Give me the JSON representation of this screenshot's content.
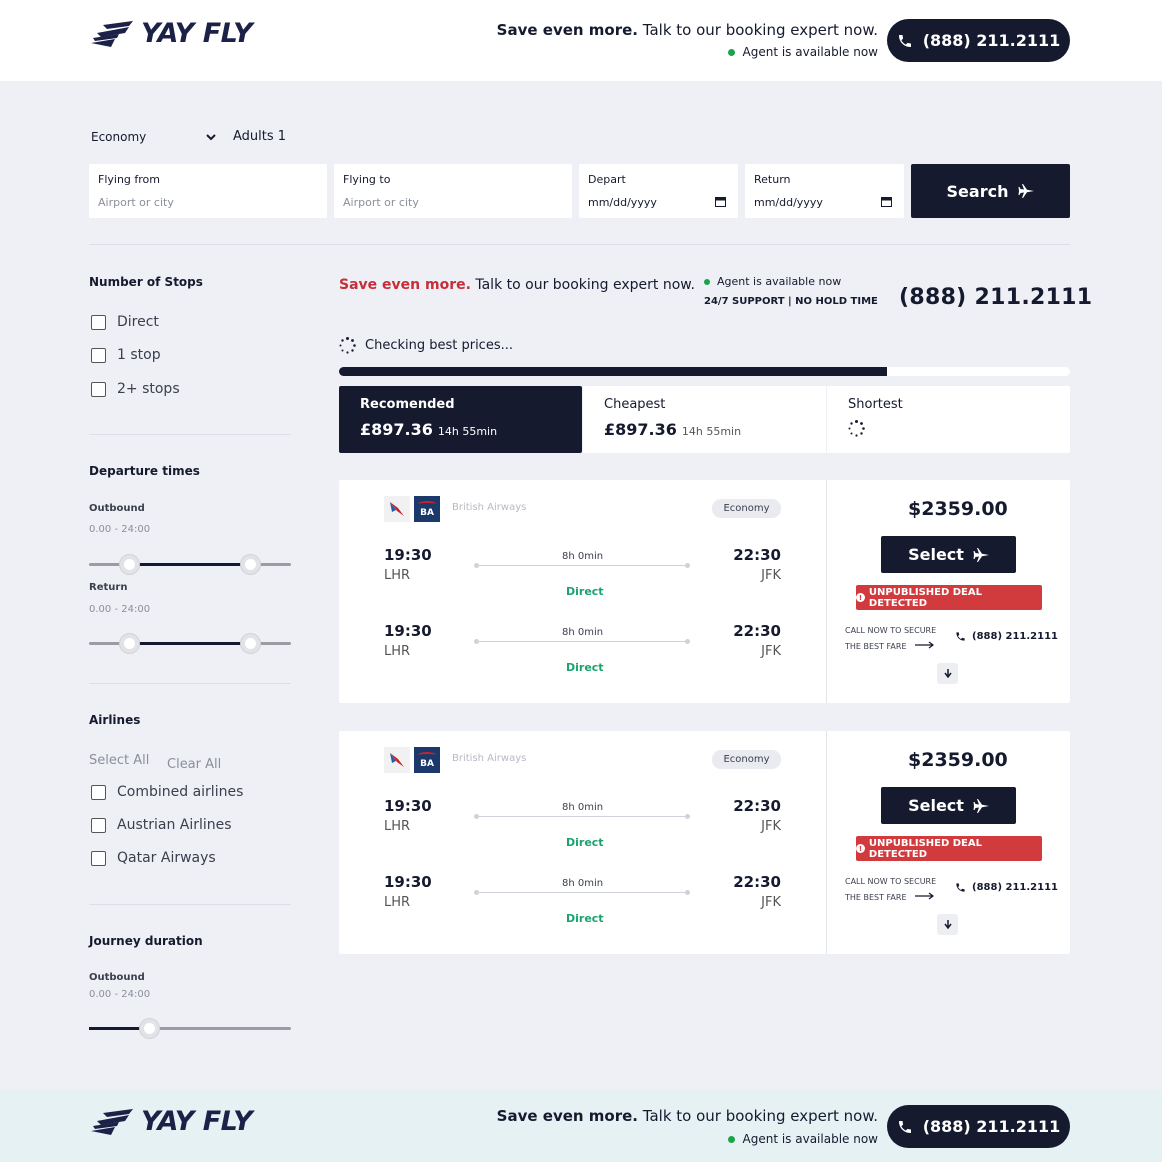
{
  "brand": {
    "name": "YAY FLY"
  },
  "header": {
    "save_bold": "Save even more.",
    "save_rest": "Talk to our booking expert now.",
    "agent": "Agent is available now",
    "phone": "(888) 211.2111"
  },
  "search": {
    "cabin": "Economy",
    "adults": "Adults 1",
    "from_label": "Flying from",
    "from_placeholder": "Airport or city",
    "to_label": "Flying to",
    "to_placeholder": "Airport or city",
    "depart_label": "Depart",
    "depart_placeholder": "mm/dd/yyyy",
    "return_label": "Return",
    "return_placeholder": "mm/dd/yyyy",
    "button": "Search"
  },
  "sidebar": {
    "stops_title": "Number of Stops",
    "stops": [
      "Direct",
      "1 stop",
      "2+ stops"
    ],
    "departure_title": "Departure times",
    "outbound_label": "Outbound",
    "outbound_range": "0.00 - 24:00",
    "return_label": "Return",
    "return_range": "0.00 - 24:00",
    "airlines_title": "Airlines",
    "select_all": "Select All",
    "clear_all": "Clear All",
    "airlines": [
      "Combined airlines",
      "Austrian Airlines",
      "Qatar Airways"
    ],
    "journey_title": "Journey duration",
    "journey_outbound_label": "Outbound",
    "journey_outbound_range": "0.00 - 24:00",
    "slider_values": {
      "outbound": [
        0.2,
        0.8
      ],
      "return": [
        0.2,
        0.8
      ],
      "journey": [
        0.3
      ]
    }
  },
  "main": {
    "save_bold": "Save even more.",
    "save_rest": "Talk to our booking expert now.",
    "agent": "Agent is available now",
    "support": "24/7 SUPPORT | NO HOLD TIME",
    "phone": "(888) 211.2111",
    "checking": "Checking best prices...",
    "progress": 0.75
  },
  "tabs": [
    {
      "label": "Recomended",
      "price": "£897.36",
      "duration": "14h 55min"
    },
    {
      "label": "Cheapest",
      "price": "£897.36",
      "duration": "14h 55min"
    },
    {
      "label": "Shortest"
    }
  ],
  "results": [
    {
      "airline": "British Airways",
      "ba_code": "BA",
      "cabin": "Economy",
      "legs": [
        {
          "dep_time": "19:30",
          "dep_airport": "LHR",
          "duration": "8h 0min",
          "arr_time": "22:30",
          "arr_airport": "JFK",
          "stops": "Direct"
        },
        {
          "dep_time": "19:30",
          "dep_airport": "LHR",
          "duration": "8h 0min",
          "arr_time": "22:30",
          "arr_airport": "JFK",
          "stops": "Direct"
        }
      ],
      "price": "$2359.00",
      "select": "Select",
      "deal": "UNPUBLISHED DEAL DETECTED",
      "call_line1": "CALL NOW TO SECURE",
      "call_line2": "THE BEST FARE",
      "phone": "(888) 211.2111"
    },
    {
      "airline": "British Airways",
      "ba_code": "BA",
      "cabin": "Economy",
      "legs": [
        {
          "dep_time": "19:30",
          "dep_airport": "LHR",
          "duration": "8h 0min",
          "arr_time": "22:30",
          "arr_airport": "JFK",
          "stops": "Direct"
        },
        {
          "dep_time": "19:30",
          "dep_airport": "LHR",
          "duration": "8h 0min",
          "arr_time": "22:30",
          "arr_airport": "JFK",
          "stops": "Direct"
        }
      ],
      "price": "$2359.00",
      "select": "Select",
      "deal": "UNPUBLISHED DEAL DETECTED",
      "call_line1": "CALL NOW TO SECURE",
      "call_line2": "THE BEST FARE",
      "phone": "(888) 211.2111"
    }
  ],
  "footer": {
    "save_bold": "Save even more.",
    "save_rest": "Talk to our booking expert now.",
    "agent": "Agent is available now",
    "phone": "(888) 211.2111"
  },
  "colors": {
    "navy": "#151a2e",
    "accent_red": "#c62f3a",
    "deal_red": "#d13b3e",
    "available_green": "#1aa34a",
    "direct_green": "#1aa36e",
    "page_bg": "#eef0f5",
    "footer_bg": "#e6f1f4"
  }
}
